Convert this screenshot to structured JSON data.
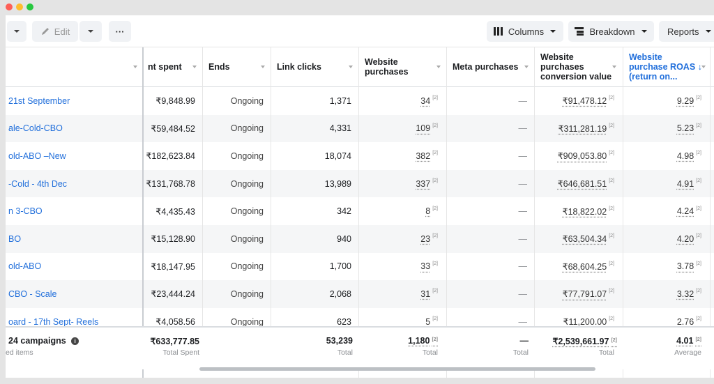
{
  "toolbar": {
    "edit_label": "Edit",
    "more_label": "···",
    "columns_label": "Columns",
    "breakdown_label": "Breakdown",
    "reports_label": "Reports"
  },
  "headers": {
    "amount_spent": "nt spent",
    "ends": "Ends",
    "link_clicks": "Link clicks",
    "website_purchases": [
      "Website",
      "purchases"
    ],
    "meta_purchases": "Meta purchases",
    "conversion_value": [
      "Website",
      "purchases",
      "conversion value"
    ],
    "roas": [
      "Website",
      "purchase ROAS ↓",
      "(return on..."
    ]
  },
  "rows": [
    {
      "name": "21st September",
      "spent": "₹9,848.99",
      "ends": "Ongoing",
      "clicks": "1,371",
      "purchases": "34",
      "meta": "—",
      "value": "₹91,478.12",
      "roas": "9.29"
    },
    {
      "name": "ale-Cold-CBO",
      "spent": "₹59,484.52",
      "ends": "Ongoing",
      "clicks": "4,331",
      "purchases": "109",
      "meta": "—",
      "value": "₹311,281.19",
      "roas": "5.23"
    },
    {
      "name": "old-ABO –New",
      "spent": "₹182,623.84",
      "ends": "Ongoing",
      "clicks": "18,074",
      "purchases": "382",
      "meta": "—",
      "value": "₹909,053.80",
      "roas": "4.98"
    },
    {
      "name": "-Cold - 4th Dec",
      "spent": "₹131,768.78",
      "ends": "Ongoing",
      "clicks": "13,989",
      "purchases": "337",
      "meta": "—",
      "value": "₹646,681.51",
      "roas": "4.91"
    },
    {
      "name": "n 3-CBO",
      "spent": "₹4,435.43",
      "ends": "Ongoing",
      "clicks": "342",
      "purchases": "8",
      "meta": "—",
      "value": "₹18,822.02",
      "roas": "4.24"
    },
    {
      "name": "BO",
      "spent": "₹15,128.90",
      "ends": "Ongoing",
      "clicks": "940",
      "purchases": "23",
      "meta": "—",
      "value": "₹63,504.34",
      "roas": "4.20"
    },
    {
      "name": "old-ABO",
      "spent": "₹18,147.95",
      "ends": "Ongoing",
      "clicks": "1,700",
      "purchases": "33",
      "meta": "—",
      "value": "₹68,604.25",
      "roas": "3.78"
    },
    {
      "name": "CBO - Scale",
      "spent": "₹23,444.24",
      "ends": "Ongoing",
      "clicks": "2,068",
      "purchases": "31",
      "meta": "—",
      "value": "₹77,791.07",
      "roas": "3.32"
    },
    {
      "name": "oard - 17th Sept- Reels",
      "spent": "₹4,058.56",
      "ends": "Ongoing",
      "clicks": "623",
      "purchases": "5",
      "meta": "—",
      "value": "₹11,200.00",
      "roas": "2.76"
    }
  ],
  "sup_marker": "[2]",
  "totals": {
    "label": "24 campaigns",
    "sublabel": "ed items",
    "spent": "₹633,777.85",
    "spent_sub": "Total Spent",
    "clicks": "53,239",
    "clicks_sub": "Total",
    "purchases": "1,180",
    "purchases_sub": "Total",
    "meta": "—",
    "meta_sub": "Total",
    "value": "₹2,539,661.97",
    "value_sub": "Total",
    "roas": "4.01",
    "roas_sub": "Average"
  },
  "colors": {
    "link": "#216fdb",
    "accent_header": "#216fdb",
    "traffic_red": "#fe5f57",
    "traffic_yellow": "#febc2e",
    "traffic_green": "#28c840"
  }
}
